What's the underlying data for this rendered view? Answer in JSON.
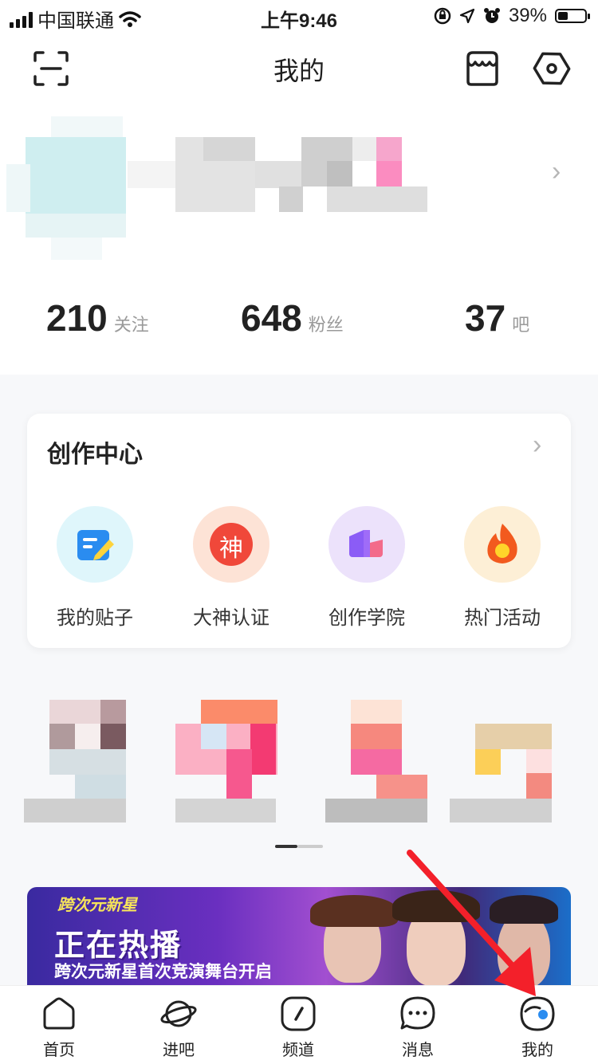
{
  "status_bar": {
    "carrier": "中国联通",
    "time": "上午9:46",
    "battery_percent": "39%",
    "battery_level": 0.39
  },
  "header": {
    "title": "我的",
    "icons": [
      "scan-icon",
      "shop-icon",
      "settings-icon"
    ]
  },
  "profile": {
    "stats": [
      {
        "value": "210",
        "label": "关注"
      },
      {
        "value": "648",
        "label": "粉丝"
      },
      {
        "value": "37",
        "label": "吧"
      }
    ]
  },
  "creation_center": {
    "title": "创作中心",
    "items": [
      {
        "label": "我的贴子",
        "icon": "post-edit-icon",
        "bg": "#dff6fb"
      },
      {
        "label": "大神认证",
        "icon": "master-badge-icon",
        "badge_text": "神",
        "bg": "#fde3d6"
      },
      {
        "label": "创作学院",
        "icon": "academy-icon",
        "bg": "#ece2fb"
      },
      {
        "label": "热门活动",
        "icon": "flame-icon",
        "bg": "#fdefd6"
      }
    ]
  },
  "banner": {
    "tag": "跨次元新星",
    "title": "正在热播",
    "subtitle": "跨次元新星首次竞演舞台开启"
  },
  "tabbar": {
    "tabs": [
      {
        "label": "首页",
        "icon": "home-icon"
      },
      {
        "label": "进吧",
        "icon": "planet-icon"
      },
      {
        "label": "频道",
        "icon": "compass-icon"
      },
      {
        "label": "消息",
        "icon": "chat-icon"
      },
      {
        "label": "我的",
        "icon": "profile-icon"
      }
    ]
  },
  "colors": {
    "accent_red": "#f3202a",
    "text_primary": "#1e1e1e",
    "text_secondary": "#9a9a9a"
  }
}
